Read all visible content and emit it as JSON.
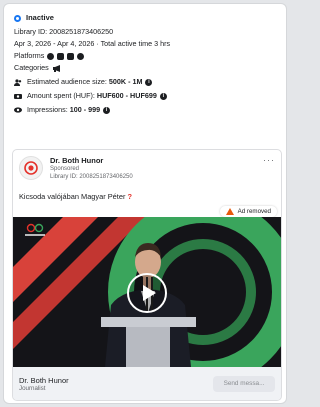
{
  "status": {
    "label": "Inactive"
  },
  "library_id": "Library ID: 2008251873406250",
  "date_range": "Apr 3, 2026 - Apr 4, 2026 · Total active time 3 hrs",
  "platforms": {
    "label": "Platforms"
  },
  "categories": {
    "label": "Categories"
  },
  "audience": {
    "label": "Estimated audience size:",
    "value": "500K - 1M"
  },
  "amount": {
    "label": "Amount spent (HUF):",
    "value": "HUF600 - HUF699"
  },
  "impressions": {
    "label": "Impressions:",
    "value": "100 - 999"
  },
  "ad": {
    "page_name": "Dr. Both Hunor",
    "sponsored": "Sponsored",
    "library_id": "Library ID: 2008251873406250",
    "more": "···",
    "text": "Kicsoda valójában Magyar Péter ",
    "text_mark": "?",
    "removed_badge": "Ad removed",
    "footer_name": "Dr. Both Hunor",
    "footer_sub": "Journalist",
    "send_label": "Send messa..."
  },
  "colors": {
    "accent": "#1877f2",
    "warning": "#e8590c",
    "red": "#e4322b",
    "ring_green": "#3aa55c",
    "stage_red": "#d8423a"
  }
}
